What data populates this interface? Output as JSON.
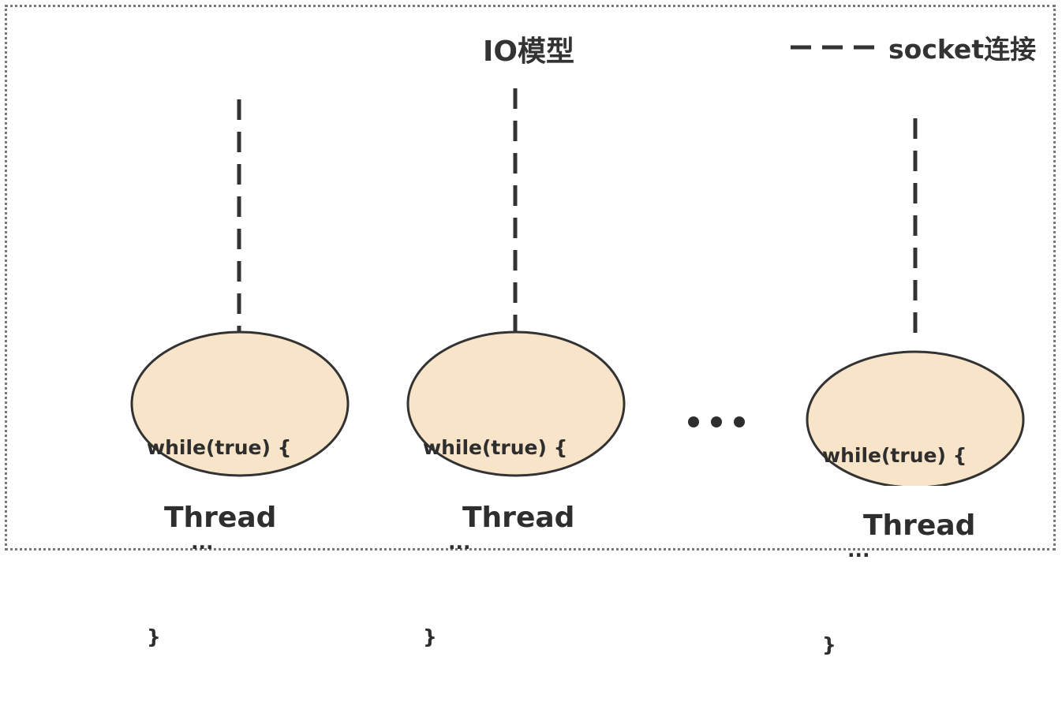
{
  "title": "IO模型",
  "legend": {
    "label": "socket连接",
    "line_color": "#333333"
  },
  "colors": {
    "oval_fill": "#f8e4c8",
    "oval_stroke": "#333333",
    "text": "#2e2e2e",
    "frame": "#777777"
  },
  "threads": [
    {
      "label": "Thread",
      "code": {
        "line1": "while(true) {",
        "line2": "...",
        "line3": "}"
      }
    },
    {
      "label": "Thread",
      "code": {
        "line1": "while(true) {",
        "line2": "...",
        "line3": "}"
      }
    },
    {
      "label": "Thread",
      "code": {
        "line1": "while(true) {",
        "line2": "...",
        "line3": "}"
      }
    }
  ],
  "ellipsis_icon": "three-dots"
}
